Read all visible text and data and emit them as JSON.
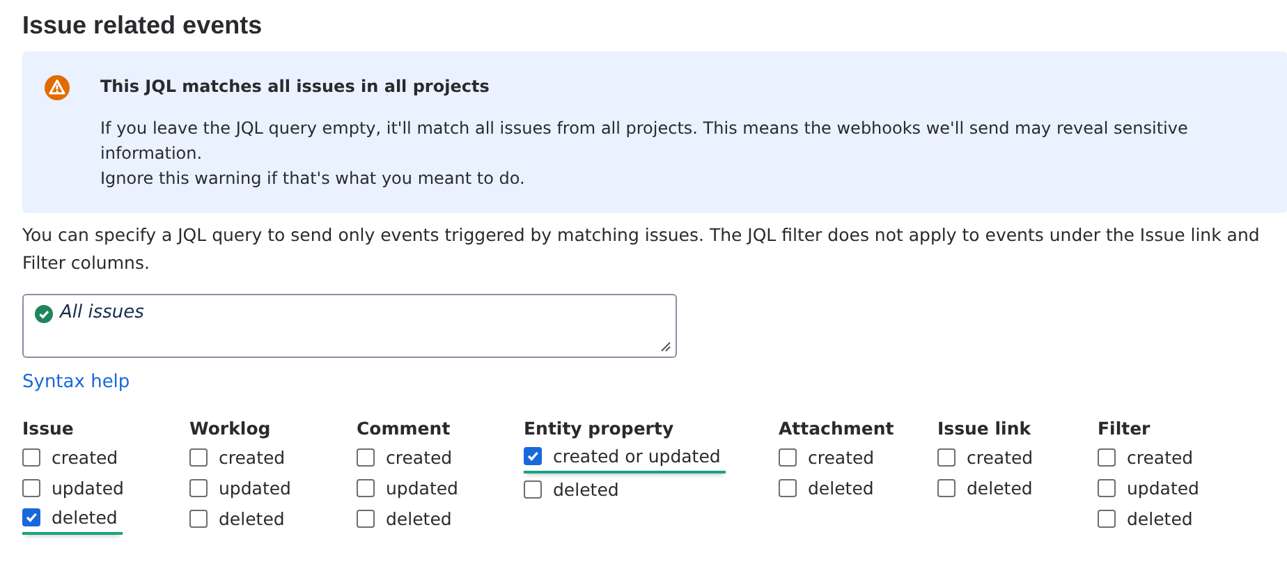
{
  "heading": "Issue related events",
  "warning": {
    "title": "This JQL matches all issues in all projects",
    "lines": [
      "If you leave the JQL query empty, it'll match all issues from all projects. This means the webhooks we'll send may reveal sensitive information.",
      "Ignore this warning if that's what you meant to do."
    ]
  },
  "description": "You can specify a JQL query to send only events triggered by matching issues. The JQL filter does not apply to events under the Issue link and Filter columns.",
  "jql_field": {
    "value": "All issues",
    "valid": true
  },
  "syntax_help": "Syntax help",
  "event_groups": [
    {
      "title": "Issue",
      "events": [
        {
          "label": "created",
          "checked": false
        },
        {
          "label": "updated",
          "checked": false
        },
        {
          "label": "deleted",
          "checked": true
        }
      ]
    },
    {
      "title": "Worklog",
      "events": [
        {
          "label": "created",
          "checked": false
        },
        {
          "label": "updated",
          "checked": false
        },
        {
          "label": "deleted",
          "checked": false
        }
      ]
    },
    {
      "title": "Comment",
      "events": [
        {
          "label": "created",
          "checked": false
        },
        {
          "label": "updated",
          "checked": false
        },
        {
          "label": "deleted",
          "checked": false
        }
      ]
    },
    {
      "title": "Entity property",
      "events": [
        {
          "label": "created or updated",
          "checked": true
        },
        {
          "label": "deleted",
          "checked": false
        }
      ]
    },
    {
      "title": "Attachment",
      "events": [
        {
          "label": "created",
          "checked": false
        },
        {
          "label": "deleted",
          "checked": false
        }
      ]
    },
    {
      "title": "Issue link",
      "events": [
        {
          "label": "created",
          "checked": false
        },
        {
          "label": "deleted",
          "checked": false
        }
      ]
    },
    {
      "title": "Filter",
      "events": [
        {
          "label": "created",
          "checked": false
        },
        {
          "label": "updated",
          "checked": false
        },
        {
          "label": "deleted",
          "checked": false
        }
      ]
    }
  ]
}
